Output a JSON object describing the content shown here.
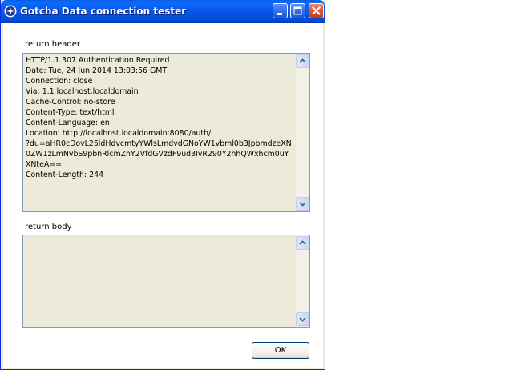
{
  "window": {
    "title": "Gotcha Data connection tester",
    "titlebar_color": "#0856e8",
    "controls": [
      "minimize-icon",
      "maximize-icon",
      "close-icon"
    ]
  },
  "header_section": {
    "label": "return header",
    "lines": [
      "HTTP/1.1 307 Authentication Required",
      "Date: Tue, 24 Jun 2014 13:03:56 GMT",
      "Connection: close",
      "Via: 1.1 localhost.localdomain",
      "Cache-Control: no-store",
      "Content-Type: text/html",
      "Content-Language: en",
      "Location: http://localhost.localdomain:8080/auth/",
      "?du=aHR0cDovL25ldHdvcmtyYWlsLmdvdGNoYW1vbml0b3JpbmdzeXN",
      "0ZW1zLmNvbS9pbnRlcmZhY2VfdGVzdF9ud3IvR290Y2hhQWxhcm0uY",
      "XNteA==",
      "Content-Length: 244"
    ]
  },
  "body_section": {
    "label": "return body",
    "value": ""
  },
  "buttons": {
    "ok_label": "OK"
  }
}
